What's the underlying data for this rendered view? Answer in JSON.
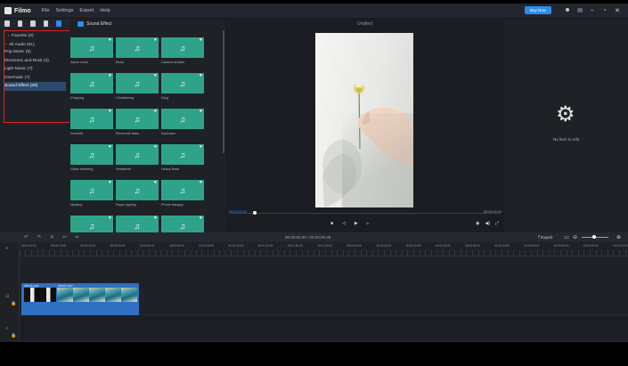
{
  "app": {
    "title": "Filmo",
    "menu": [
      "File",
      "Settings",
      "Export",
      "Help"
    ],
    "buy_label": "Buy Now",
    "window_icons": [
      "user-icon",
      "mail-icon",
      "minimize-icon",
      "maximize-icon",
      "close-icon"
    ]
  },
  "categories": {
    "items": [
      {
        "label": "Favorite (0)",
        "level": 1,
        "caret": "▸"
      },
      {
        "label": "All Audio (51)",
        "level": 2,
        "caret": "▾"
      },
      {
        "label": "Pop Music (5)",
        "level": 3
      },
      {
        "label": "Electronic and Rock (4)",
        "level": 3
      },
      {
        "label": "Light Music (7)",
        "level": 3
      },
      {
        "label": "Cinematic (7)",
        "level": 3
      },
      {
        "label": "Sound Effect (28)",
        "level": 3,
        "selected": true
      }
    ]
  },
  "media": {
    "title": "Sound Effect",
    "tiles": [
      "Alarm clock",
      "Beep",
      "Camera shutter",
      "Clapping",
      "Clockticking",
      "Ding",
      "Doorbell",
      "Electronic bass",
      "Explosion",
      "Glass breaking",
      "Heartbeat",
      "Heavy Bass",
      "Mystery",
      "Paper ripping",
      "Phone hangup",
      "",
      "",
      ""
    ]
  },
  "preview": {
    "title": "Untitled",
    "time_current": "00:00:00.00",
    "time_total": "00:00:09.29"
  },
  "properties": {
    "empty_text": "No item to edit"
  },
  "timeline": {
    "time_display": "00:00:00.00 / 00:00:09.29",
    "export_label": "Export",
    "ruler": [
      "00:00:00:00",
      "00:00:10:00",
      "00:00:20:00",
      "00:00:30:00",
      "00:00:40:00",
      "00:00:50:00",
      "00:01:00:00",
      "00:01:10:00",
      "00:01:20:00",
      "00:01:30:00",
      "00:01:40:00",
      "00:01:50:00",
      "00:02:00:00",
      "00:02:10:00",
      "00:02:20:00",
      "00:02:30:00",
      "00:02:40:00",
      "00:02:50:00",
      "00:03:00:00",
      "00:03:10:00",
      "00:03:20:00"
    ],
    "clip_labels": [
      "video1.mp4",
      "video2.mp4"
    ]
  }
}
